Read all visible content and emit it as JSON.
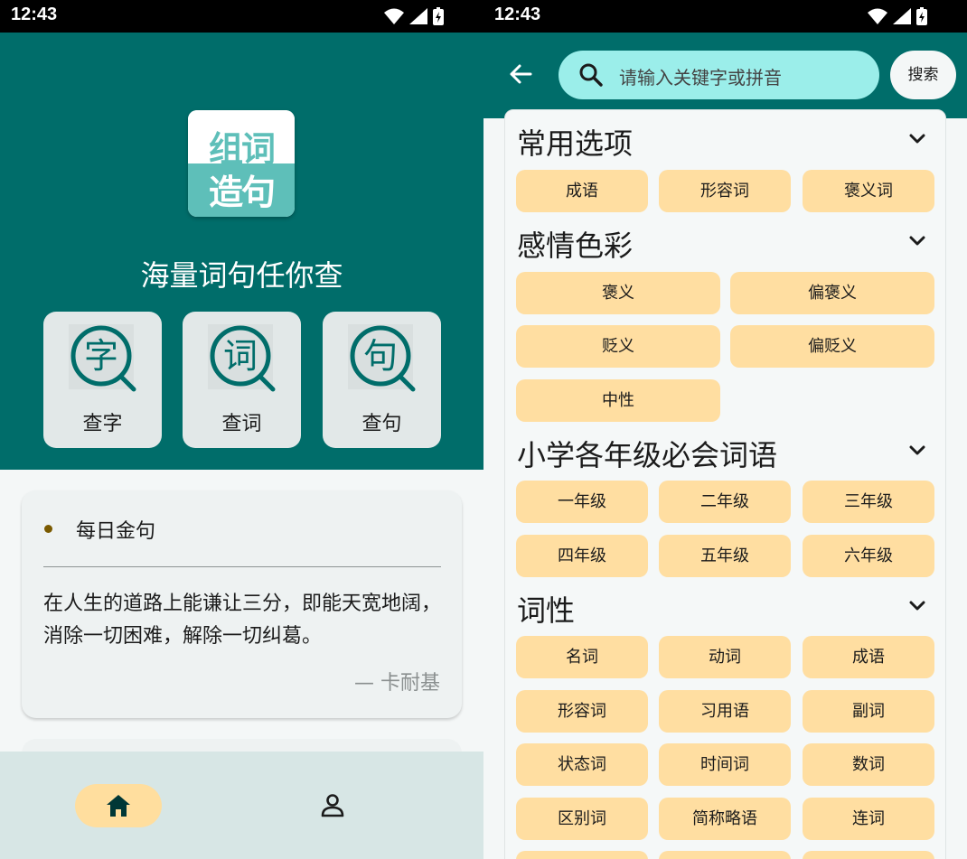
{
  "status_bar": {
    "time_left": "12:43",
    "time_right": "12:43"
  },
  "home": {
    "logo": {
      "line1": "组词",
      "line2": "造句"
    },
    "slogan": "海量词句任你查",
    "actions": [
      {
        "glyph": "字",
        "label": "查字"
      },
      {
        "glyph": "词",
        "label": "查词"
      },
      {
        "glyph": "句",
        "label": "查句"
      }
    ],
    "daily": {
      "title": "每日金句",
      "quote": "在人生的道路上能谦让三分，即能天宽地阔，消除一切困难，解除一切纠葛。",
      "author": "— 卡耐基"
    },
    "nav": [
      {
        "icon": "home-icon",
        "active": true
      },
      {
        "icon": "user-icon",
        "active": false
      }
    ]
  },
  "search_screen": {
    "placeholder": "请输入关键字或拼音",
    "search_label": "搜索",
    "sections": [
      {
        "title": "常用选项",
        "chips": [
          "成语",
          "形容词",
          "褒义词"
        ]
      },
      {
        "title": "感情色彩",
        "chips": [
          "褒义",
          "偏褒义",
          "贬义",
          "偏贬义",
          "中性"
        ]
      },
      {
        "title": "小学各年级必会词语",
        "chips": [
          "一年级",
          "二年级",
          "三年级",
          "四年级",
          "五年级",
          "六年级"
        ]
      },
      {
        "title": "词性",
        "chips": [
          "名词",
          "动词",
          "成语",
          "形容词",
          "习用语",
          "副词",
          "状态词",
          "时间词",
          "数词",
          "区别词",
          "简称略语",
          "连词"
        ]
      }
    ]
  },
  "colors": {
    "primary": "#006d6a",
    "chip": "#ffdea1",
    "search_bg": "#9beeea",
    "logo_teal": "#5ebfb9"
  }
}
